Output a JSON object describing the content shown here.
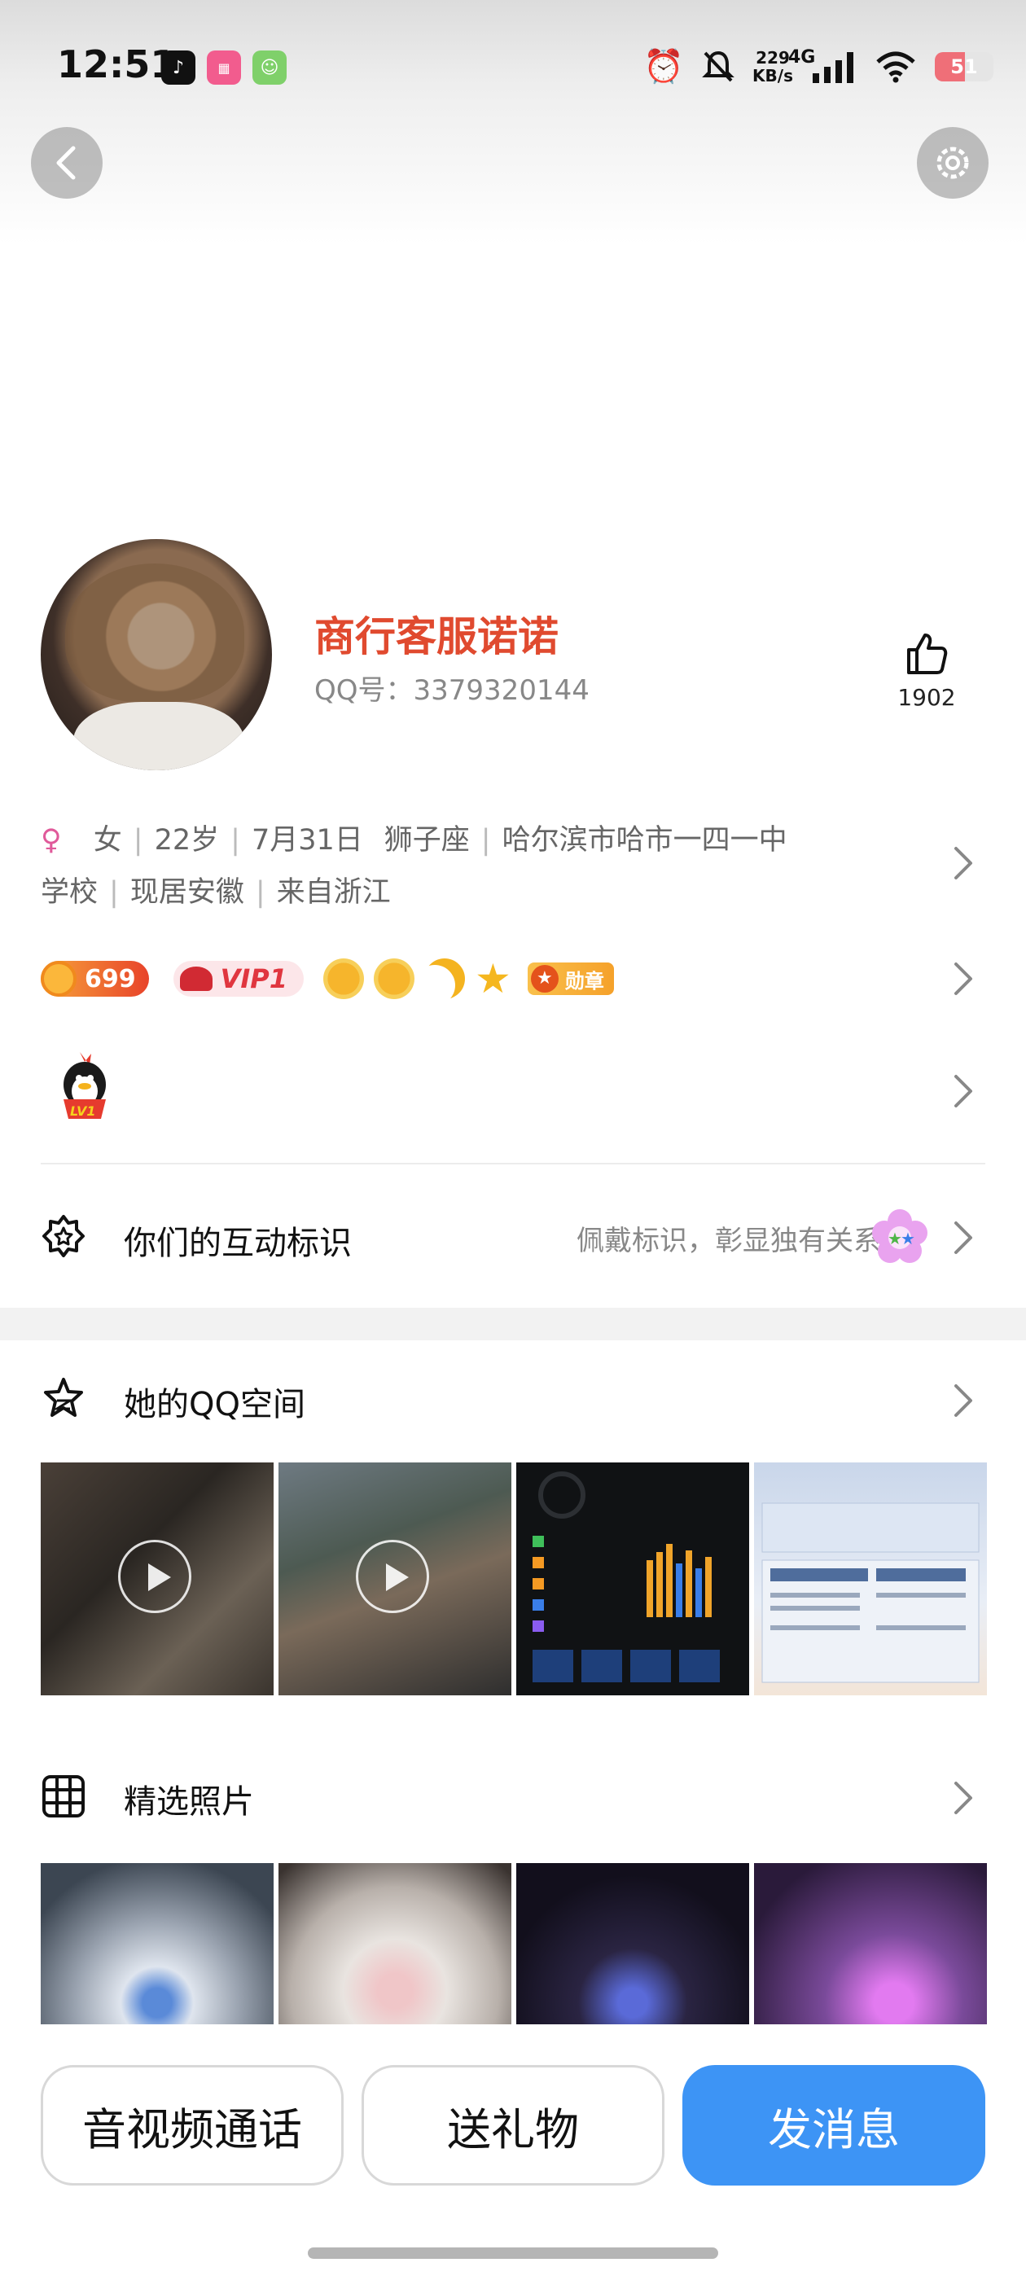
{
  "status_bar": {
    "time": "12:51",
    "net_speed_value": "229",
    "net_speed_unit": "KB/s",
    "network_type": "4G",
    "battery": "51",
    "battery_level_percent": 51
  },
  "profile": {
    "name": "商行客服诺诺",
    "qq_label": "QQ号：3379320144",
    "like_count": "1902",
    "gender_symbol": "♀",
    "gender": "女",
    "age": "22岁",
    "birthday": "7月31日",
    "zodiac": "狮子座",
    "school_prefix": "哈尔滨市哈市一四一中",
    "school_suffix": "学校",
    "current_location": "现居安徽",
    "hometown": "来自浙江"
  },
  "badges": {
    "coins": "699",
    "vip": "VIP1",
    "medal": "勋章"
  },
  "interaction": {
    "title": "你们的互动标识",
    "hint": "佩戴标识，彰显独有关系"
  },
  "qzone": {
    "title": "她的QQ空间"
  },
  "featured": {
    "title": "精选照片"
  },
  "actions": {
    "call": "音视频通话",
    "gift": "送礼物",
    "message": "发消息"
  },
  "colors": {
    "name": "#e04a2f",
    "primary_button": "#3d94f5",
    "section_gap": "#f2f2f2"
  }
}
